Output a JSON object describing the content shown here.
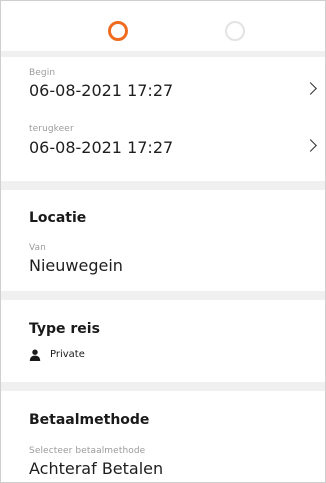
{
  "stepper": {
    "steps": [
      {
        "state": "active",
        "color": "#ef6c1f"
      },
      {
        "state": "inactive",
        "color": "#e3e3e3"
      }
    ]
  },
  "schedule": {
    "begin": {
      "caption": "Begin",
      "value": "06-08-2021 17:27"
    },
    "return": {
      "caption": "terugkeer",
      "value": "06-08-2021 17:27"
    }
  },
  "location": {
    "heading": "Locatie",
    "from": {
      "caption": "Van",
      "value": "Nieuwegein"
    }
  },
  "trip_type": {
    "heading": "Type reis",
    "option": {
      "icon": "person-icon",
      "label": "Private"
    }
  },
  "payment": {
    "heading": "Betaalmethode",
    "method": {
      "caption": "Selecteer betaalmethode",
      "value": "Achteraf Betalen"
    }
  },
  "colors": {
    "accent": "#ef6c1f",
    "divider": "#f0f0f0",
    "caption": "#9b9b9b"
  }
}
